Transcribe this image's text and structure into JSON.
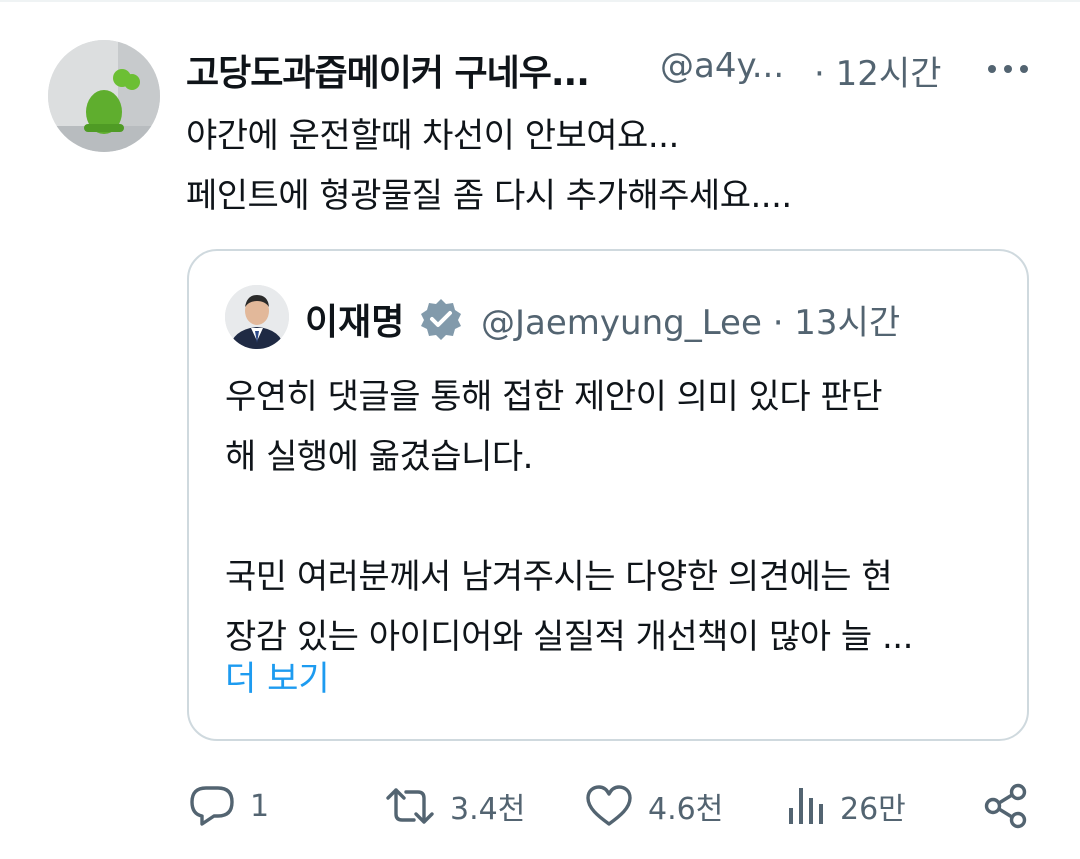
{
  "author": {
    "name": "고당도과즙메이커 구네우...",
    "handle": "@a4y...",
    "time": "· 12시간"
  },
  "tweet": {
    "text": "야간에 운전할때 차선이 안보여요...\n페인트에 형광물질 좀 다시 추가해주세요...."
  },
  "quote": {
    "name": "이재명",
    "handle": "@Jaemyung_Lee · 13시간",
    "text": "우연히 댓글을 통해 접한 제안이 의미 있다 판단\n해 실행에 옮겼습니다.\n\n국민 여러분께서 남겨주시는 다양한 의견에는 현\n장감 있는 아이디어와 실질적 개선책이 많아 늘 ...",
    "show_more": "더 보기"
  },
  "actions": {
    "reply_count": "1",
    "retweet_count": "3.4천",
    "like_count": "4.6천",
    "views_count": "26만"
  },
  "icons": {
    "more": "more-horizontal-icon",
    "verified": "verified-badge-icon",
    "reply": "reply-icon",
    "retweet": "retweet-icon",
    "like": "heart-icon",
    "views": "views-icon",
    "share": "share-icon"
  },
  "colors": {
    "text": "#0f1419",
    "secondary": "#536471",
    "link": "#1d9bf0",
    "border": "#cfd9de",
    "verified_badge": "#829aab"
  }
}
